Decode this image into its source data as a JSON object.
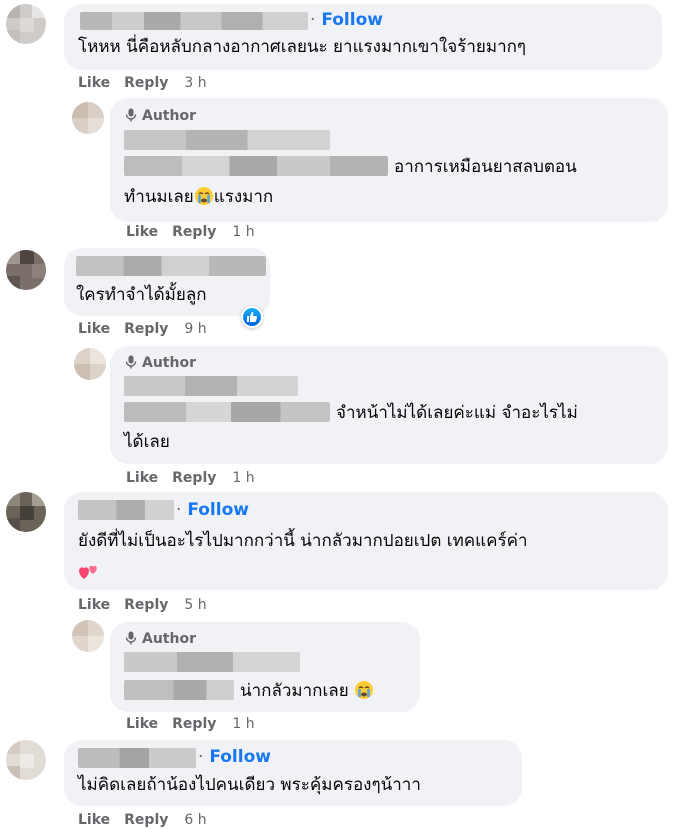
{
  "comments": [
    {
      "follow": "Follow",
      "text": "โหหห นี่คือหลับกลางอากาศเลยนะ ยาแรงมากเขาใจร้ายมากๆ",
      "actions": {
        "like": "Like",
        "reply": "Reply",
        "time": "3 h"
      },
      "reply": {
        "author": "Author",
        "text_line1": "อาการเหมือนยาสลบตอน",
        "text_line2a": "ทำนมเลย",
        "text_line2b": "แรงมาก",
        "emoji": "crying-face",
        "actions": {
          "like": "Like",
          "reply": "Reply",
          "time": "1 h"
        }
      }
    },
    {
      "text": "ใครทำจำได้มั้ยลูก",
      "reaction": "like",
      "actions": {
        "like": "Like",
        "reply": "Reply",
        "time": "9 h"
      },
      "reply": {
        "author": "Author",
        "text_line1": "จำหน้าไม่ได้เลยค่ะแม่ จำอะไรไม่",
        "text_line2": "ได้เลย",
        "actions": {
          "like": "Like",
          "reply": "Reply",
          "time": "1 h"
        }
      }
    },
    {
      "follow": "Follow",
      "text": "ยังดีที่ไม่เป็นอะไรไปมากกว่านี้ น่ากลัวมากปอยเปต เทคแคร์ค่า",
      "emoji": "two-hearts",
      "actions": {
        "like": "Like",
        "reply": "Reply",
        "time": "5 h"
      },
      "reply": {
        "author": "Author",
        "text_line1": "น่ากลัวมากเลย",
        "emoji": "crying-face",
        "actions": {
          "like": "Like",
          "reply": "Reply",
          "time": "1 h"
        }
      }
    },
    {
      "follow": "Follow",
      "text": "ไม่คิดเลยถ้าน้องไปคนเดียว พระคุ้มครองๆน้าาา",
      "actions": {
        "like": "Like",
        "reply": "Reply",
        "time": "6 h"
      }
    }
  ],
  "colors": {
    "bubble": "#f0f2f5",
    "link": "#1877f2",
    "meta": "#65676b",
    "text": "#050505"
  }
}
